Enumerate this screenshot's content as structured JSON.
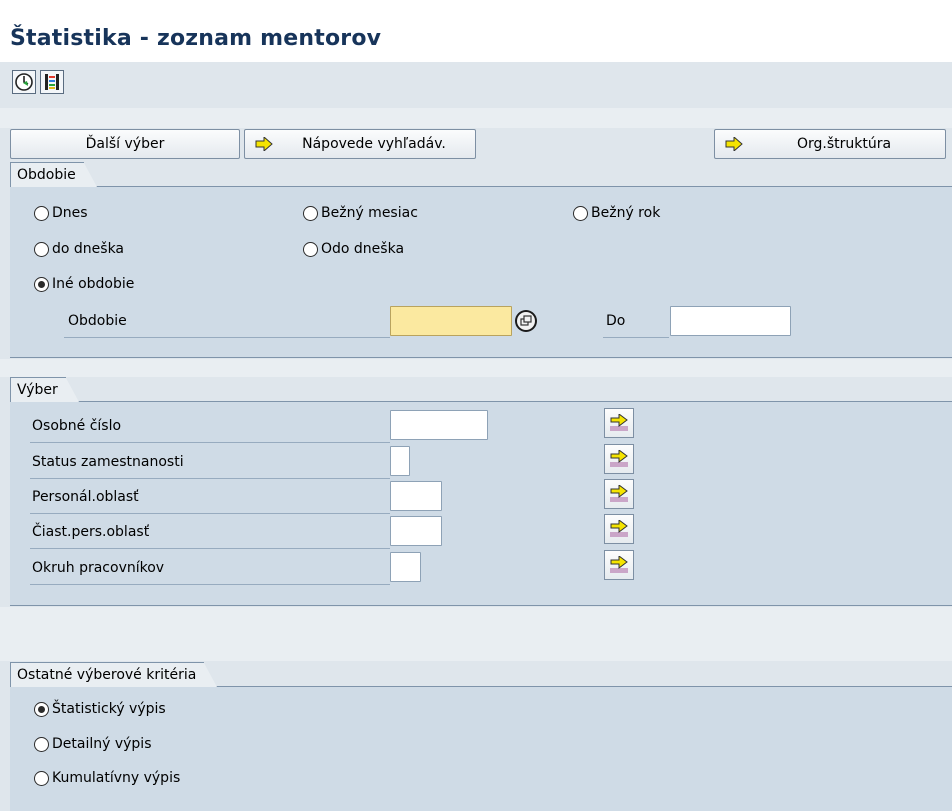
{
  "title": "Štatistika - zoznam mentorov",
  "toolbar": {
    "execute_icon": "execute-clock-icon",
    "variant_icon": "variant-list-icon"
  },
  "buttons": {
    "dalsi_vyber": "Ďalší výber",
    "napovede": "Nápovede vyhľadáv.",
    "org_struktura": "Org.štruktúra"
  },
  "obdobie": {
    "group_title": "Obdobie",
    "radios": {
      "dnes": "Dnes",
      "bezny_mesiac": "Bežný mesiac",
      "bezny_rok": "Bežný rok",
      "do_dneska": "do dneška",
      "odo_dneska": "Odo dneška",
      "ine_obdobie": "Iné obdobie"
    },
    "selected": "ine_obdobie",
    "period_label": "Obdobie",
    "period_value": "",
    "do_label": "Do",
    "do_value": ""
  },
  "vyber": {
    "group_title": "Výber",
    "rows": [
      {
        "label": "Osobné číslo",
        "value": ""
      },
      {
        "label": "Status zamestnanosti",
        "value": ""
      },
      {
        "label": "Personál.oblasť",
        "value": ""
      },
      {
        "label": "Čiast.pers.oblasť",
        "value": ""
      },
      {
        "label": "Okruh pracovníkov",
        "value": ""
      }
    ]
  },
  "ostatne": {
    "group_title": "Ostatné výberové kritéria",
    "radios": {
      "statisticky": "Štatistický výpis",
      "detailny": "Detailný výpis",
      "kumulativny": "Kumulatívny výpis"
    },
    "selected": "statisticky"
  },
  "colors": {
    "title": "#17345a",
    "background": "#dfe6ec",
    "group": "#cfdbe6",
    "required_field": "#fbe9a0",
    "arrow_yellow": "#f5e400"
  }
}
